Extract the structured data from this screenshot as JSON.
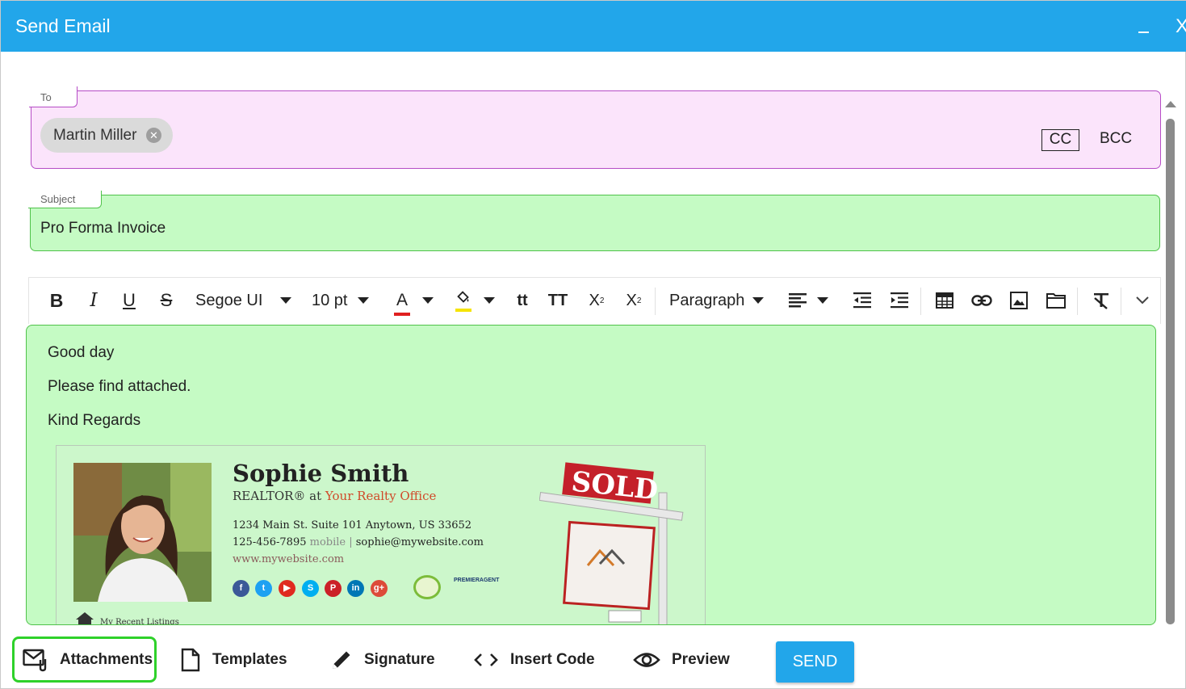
{
  "window": {
    "title": "Send Email",
    "minimize_icon": "minimize-icon",
    "close_label": "X"
  },
  "to_field": {
    "label": "To",
    "recipients": [
      {
        "name": "Martin Miller",
        "remove_icon": "remove-chip-icon"
      }
    ],
    "cc_label": "CC",
    "bcc_label": "BCC",
    "background": "#fbe4fb",
    "border_color": "#b64cc6"
  },
  "subject_field": {
    "label": "Subject",
    "value": "Pro Forma Invoice",
    "background": "#c5fbc4",
    "border_color": "#4fc24a"
  },
  "toolbar": {
    "font_family": "Segoe UI",
    "font_size": "10 pt",
    "block_format": "Paragraph",
    "font_color_indicator": "#e02020",
    "highlight_color_indicator": "#f5e400",
    "icons": [
      "bold-icon",
      "italic-icon",
      "underline-icon",
      "strikethrough-icon",
      "font-color-icon",
      "highlight-icon",
      "lowercase-icon",
      "uppercase-icon",
      "superscript-icon",
      "subscript-icon",
      "align-icon",
      "outdent-icon",
      "indent-icon",
      "table-icon",
      "link-icon",
      "image-icon",
      "folder-icon",
      "clear-format-icon",
      "more-icon"
    ]
  },
  "body": {
    "lines": [
      "Good day",
      "Please find attached.",
      "Kind Regards"
    ]
  },
  "signature": {
    "name": "Sophie Smith",
    "role_prefix": "REALTOR® at ",
    "role_company": "Your Realty Office",
    "address": "1234 Main St. Suite 101 Anytown, US 33652",
    "phone": "125-456-7895",
    "phone_type": " mobile | ",
    "email": "sophie@mywebsite.com",
    "website": "www.mywebsite.com",
    "social_icons": [
      "facebook-icon",
      "twitter-icon",
      "youtube-icon",
      "skype-icon",
      "pinterest-icon",
      "linkedin-icon",
      "googleplus-icon"
    ],
    "sold_sign_text": "SOLD",
    "premier_text": "PREMIERAGENT",
    "listings_text": "My Recent Listings"
  },
  "actions": {
    "attachments": "Attachments",
    "templates": "Templates",
    "signature": "Signature",
    "insert_code": "Insert Code",
    "preview": "Preview",
    "send": "SEND"
  }
}
